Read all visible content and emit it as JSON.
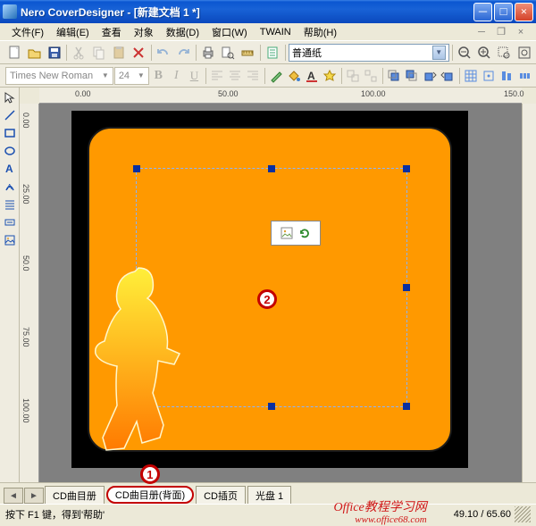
{
  "title": "Nero CoverDesigner - [新建文档 1 *]",
  "menus": [
    "文件(F)",
    "编辑(E)",
    "查看",
    "对象",
    "数据(D)",
    "窗口(W)",
    "TWAIN",
    "帮助(H)"
  ],
  "paper_type": "普通纸",
  "font_name": "Times New Roman",
  "font_size": "24",
  "ruler_h_marks": [
    "0.00",
    "50.00",
    "100.00",
    "150.0"
  ],
  "ruler_v_marks": [
    "0.00",
    "25.00",
    "50.0",
    "75.00",
    "100.00"
  ],
  "tabs": {
    "prev": "◄",
    "next": "►",
    "items": [
      "CD曲目册",
      "CD曲目册(背面)",
      "CD插页",
      "光盘 1"
    ],
    "active_index": 1
  },
  "callouts": {
    "tab": "1",
    "canvas": "2"
  },
  "status_help": "按下 F1 键，得到'帮助'",
  "status_coords": "49.10 / 65.60",
  "watermark_text": "Office教程学习网",
  "watermark_url": "www.office68.com"
}
